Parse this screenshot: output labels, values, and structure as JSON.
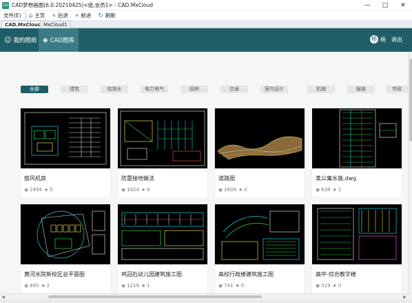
{
  "window": {
    "title": "CAD梦想画图(6.0.20210425)<纸,会员1> - CAD.MxCloud",
    "app_icon": "CAD",
    "controls": [
      "—",
      "□",
      "✕"
    ]
  },
  "menubar": {
    "file": "文件(E)",
    "nav": [
      {
        "label": "主页",
        "icon": "home-icon",
        "glyph": "⌂"
      },
      {
        "label": "后退",
        "icon": "back-icon",
        "glyph": "«"
      },
      {
        "label": "前进",
        "icon": "forward-icon",
        "glyph": "»"
      },
      {
        "label": "刷新",
        "icon": "refresh-icon",
        "glyph": "↻"
      }
    ]
  },
  "tabs": [
    "CAD.MxCloud",
    "MxCloud1"
  ],
  "header": {
    "nav": [
      {
        "label": "我的图纸",
        "icon": "user-icon",
        "glyph": "☺"
      },
      {
        "label": "CAD图库",
        "icon": "layers-icon",
        "glyph": "◈"
      }
    ],
    "user_initial": "杨",
    "user_name": "杨",
    "logout": "退出",
    "colors": {
      "header": "#1f5e66",
      "active": "#3c7b83"
    }
  },
  "categories": [
    "全部",
    "建筑",
    "给排水",
    "电力电气",
    "园林",
    "交通",
    "室内设计",
    "机械",
    "服装",
    "市政"
  ],
  "active_category": "全部",
  "cards": [
    {
      "title": "鼓风机房",
      "views": "2494",
      "stars": "5",
      "thumb": "plan"
    },
    {
      "title": "防雷接地做法",
      "views": "1624",
      "stars": "6",
      "thumb": "detail"
    },
    {
      "title": "道路图",
      "views": "1609",
      "stars": "0",
      "thumb": "road"
    },
    {
      "title": "某公寓水施.dwg",
      "views": "638",
      "stars": "1",
      "thumb": "water"
    },
    {
      "title": "黄河水院新校区总平面图",
      "views": "685",
      "stars": "2",
      "thumb": "site"
    },
    {
      "title": "鸡冠石幼儿园建筑施工图",
      "views": "1219",
      "stars": "1",
      "thumb": "sheets"
    },
    {
      "title": "高校行政楼建筑施工图",
      "views": "741",
      "stars": "0",
      "thumb": "admin"
    },
    {
      "title": "高中-综合教学楼",
      "views": "519",
      "stars": "0",
      "thumb": "school"
    }
  ],
  "icons": {
    "views": "eye-icon",
    "stars": "star-icon"
  }
}
